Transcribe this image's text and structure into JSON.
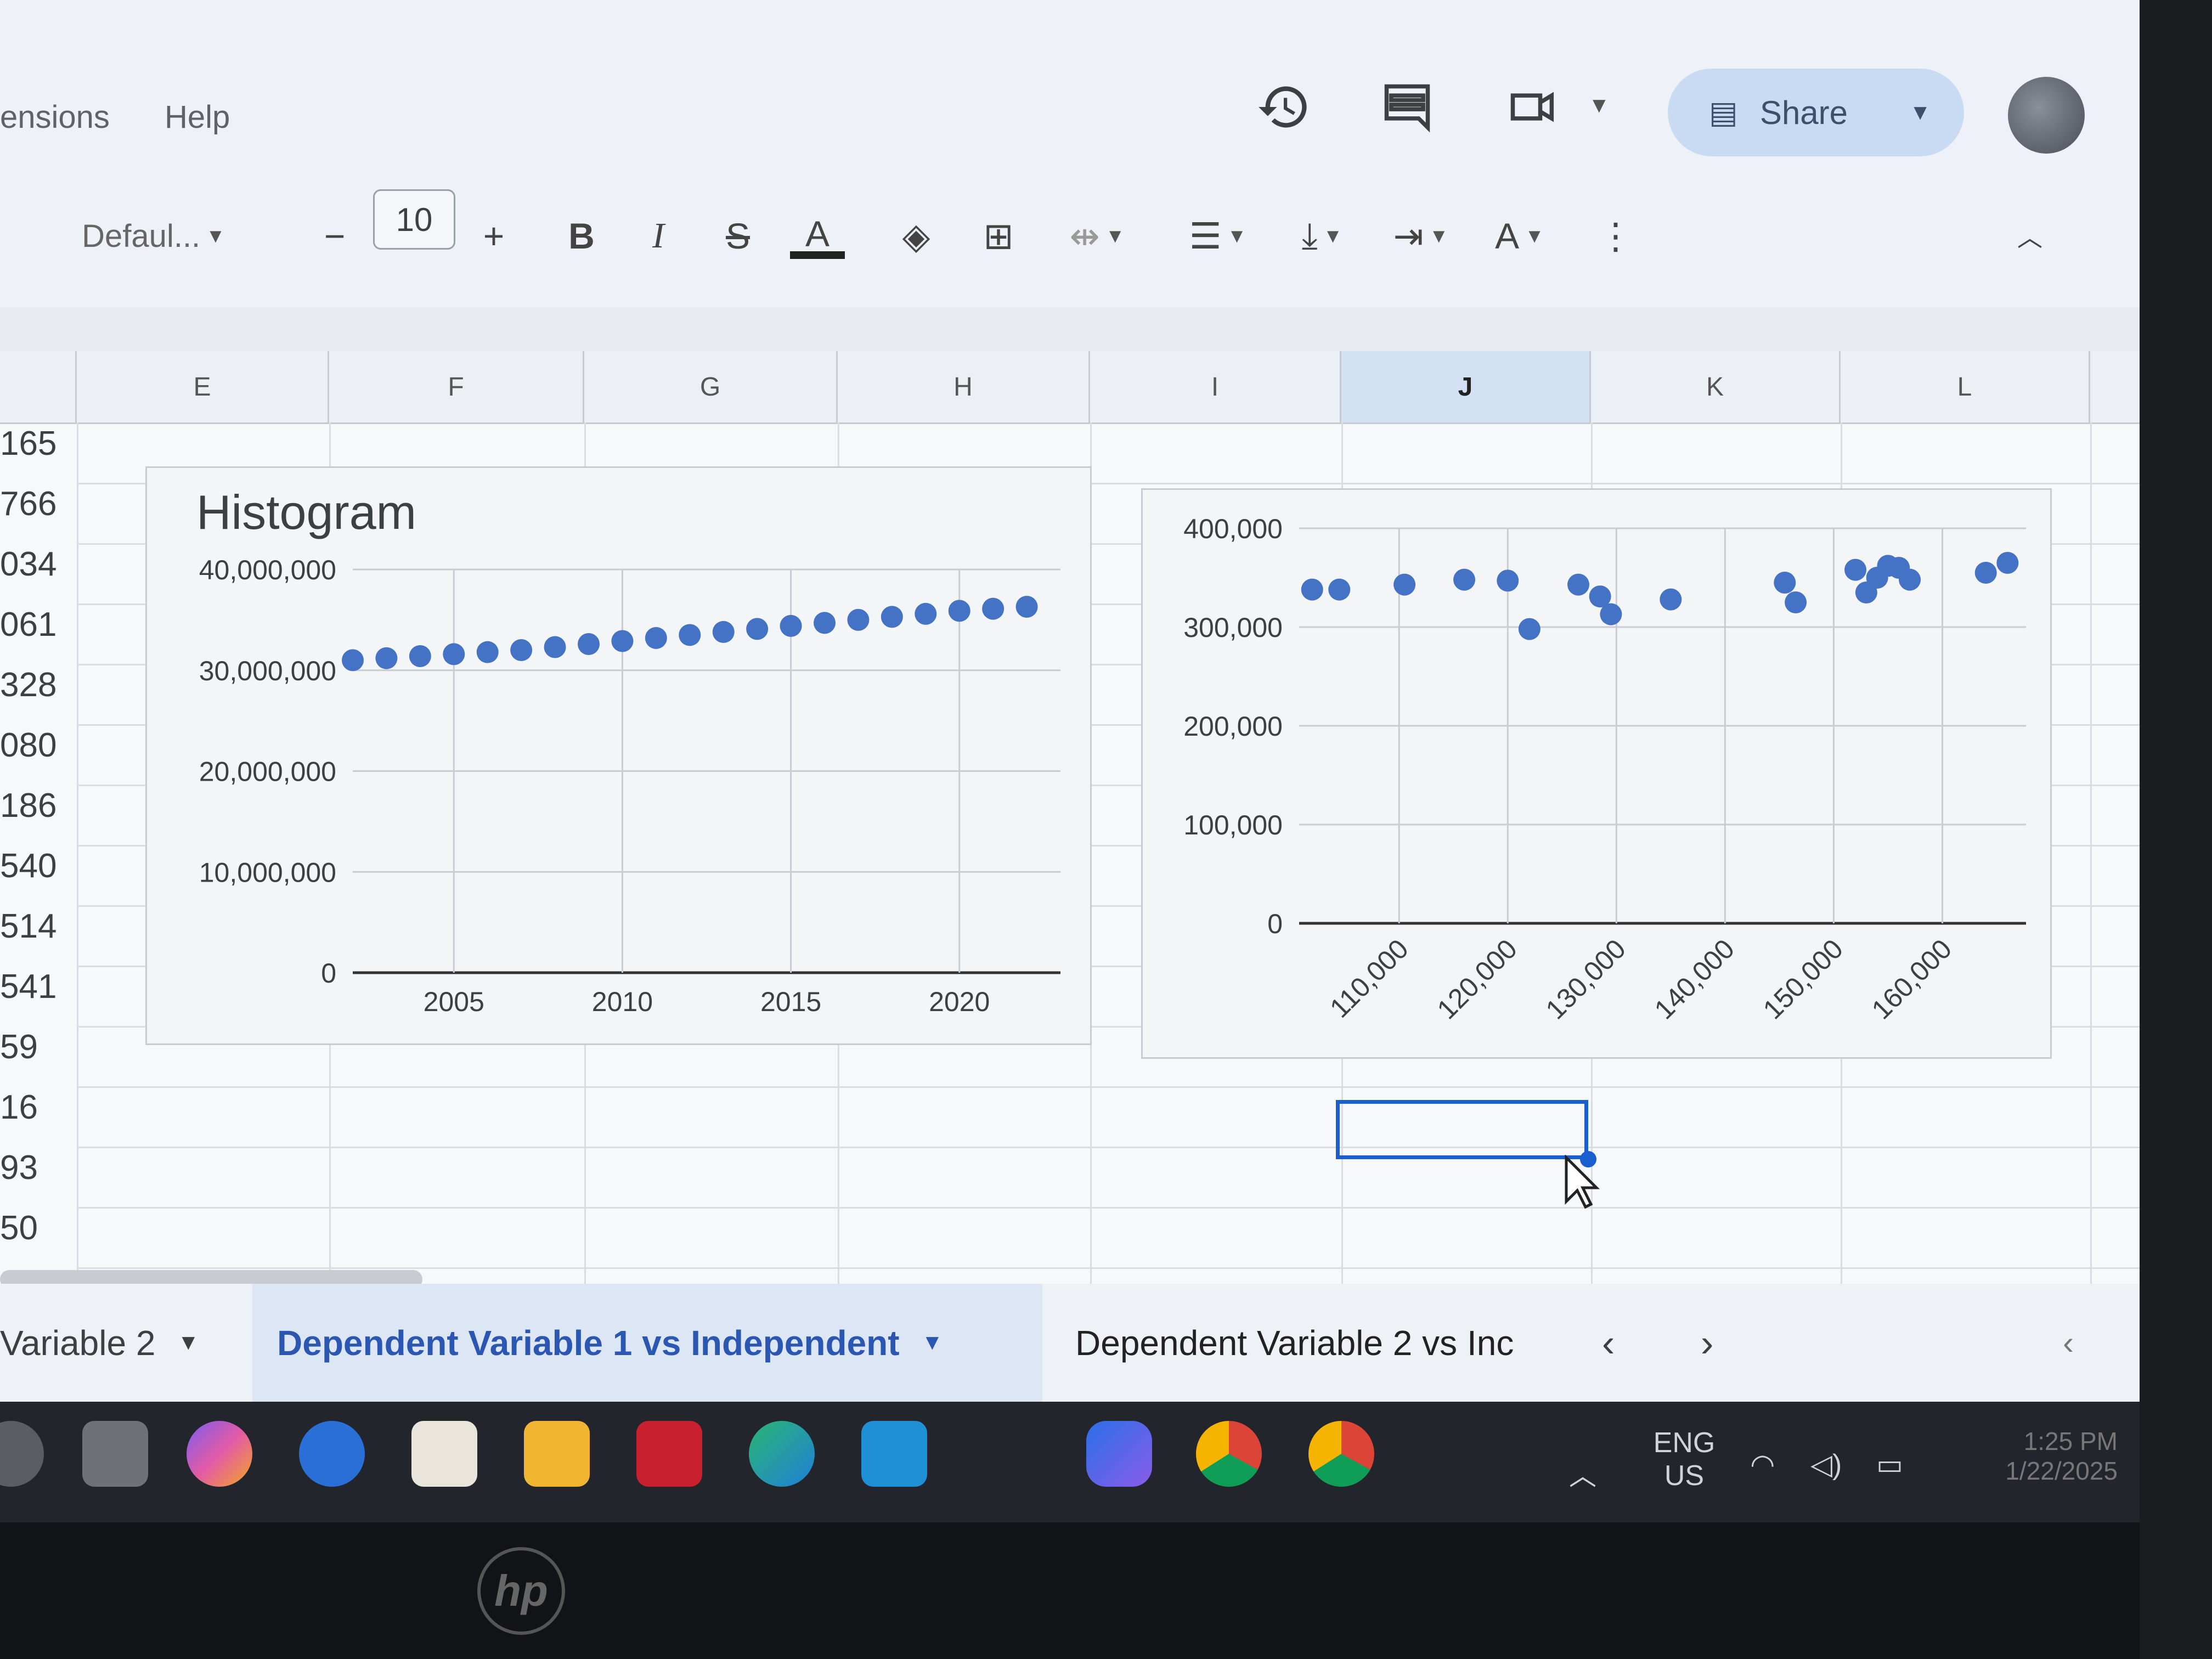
{
  "menu": {
    "extensions": "ensions",
    "help": "Help"
  },
  "header": {
    "share_label": "Share"
  },
  "toolbar": {
    "font_name": "Defaul...",
    "font_size": "10",
    "minus": "−",
    "plus": "+",
    "bold": "B",
    "italic": "I",
    "text_color": "A",
    "text_format": "A"
  },
  "columns": [
    "E",
    "F",
    "G",
    "H",
    "I",
    "J",
    "K",
    "L"
  ],
  "selected_column": "J",
  "row_numbers": [
    "165",
    "766",
    "034",
    "061",
    "328",
    "080",
    "186",
    "540",
    "514",
    "541",
    "59",
    "16",
    "93",
    "50"
  ],
  "chart_data": [
    {
      "type": "scatter",
      "title": "Histogram",
      "xlabel": "",
      "ylabel": "",
      "x_ticks": [
        "2005",
        "2010",
        "2015",
        "2020"
      ],
      "y_ticks": [
        "0",
        "10,000,000",
        "20,000,000",
        "30,000,000",
        "40,000,000"
      ],
      "xlim": [
        2002,
        2023
      ],
      "ylim": [
        0,
        40000000
      ],
      "grid": true,
      "x": [
        2002,
        2003,
        2004,
        2005,
        2006,
        2007,
        2008,
        2009,
        2010,
        2011,
        2012,
        2013,
        2014,
        2015,
        2016,
        2017,
        2018,
        2019,
        2020,
        2021,
        2022
      ],
      "y": [
        31000000,
        31200000,
        31400000,
        31600000,
        31800000,
        32000000,
        32300000,
        32600000,
        32900000,
        33200000,
        33500000,
        33800000,
        34100000,
        34400000,
        34700000,
        35000000,
        35300000,
        35600000,
        35900000,
        36100000,
        36300000
      ]
    },
    {
      "type": "scatter",
      "title": "",
      "xlabel": "",
      "ylabel": "",
      "x_ticks": [
        "110,000",
        "120,000",
        "130,000",
        "140,000",
        "150,000",
        "160,000"
      ],
      "y_ticks": [
        "0",
        "100,000",
        "200,000",
        "300,000",
        "400,000"
      ],
      "xlim": [
        100800,
        167700
      ],
      "ylim": [
        0,
        400000
      ],
      "grid": true,
      "x": [
        102000,
        104500,
        110500,
        116000,
        120000,
        122000,
        126500,
        128500,
        129500,
        135000,
        145500,
        146500,
        152000,
        154000,
        153000,
        155000,
        156000,
        157000,
        164000,
        166000
      ],
      "y": [
        338000,
        338000,
        343000,
        348000,
        347000,
        298000,
        343000,
        331000,
        313000,
        328000,
        345000,
        325000,
        358000,
        350000,
        335000,
        362000,
        360000,
        348000,
        355000,
        365000
      ]
    }
  ],
  "sheet_tabs": {
    "tab1": "Variable 2",
    "tab2": "Dependent Variable 1 vs Independent",
    "tab3": "Dependent Variable 2 vs Inc"
  },
  "systray": {
    "lang1": "ENG",
    "lang2": "US",
    "time": "1:25 PM",
    "date": "1/22/2025"
  },
  "taskbar_icons": [
    "windows-icon",
    "search-icon",
    "copilot-icon",
    "help-icon",
    "store-icon",
    "file-explorer-icon",
    "mcafee-icon",
    "edge-icon",
    "myhp-icon",
    "copilot-app-icon",
    "chrome-icon",
    "chrome-profile-icon"
  ],
  "colors": {
    "accent": "#1a5fd0",
    "point": "#4472c4",
    "share_bg": "#c9dbf3"
  }
}
